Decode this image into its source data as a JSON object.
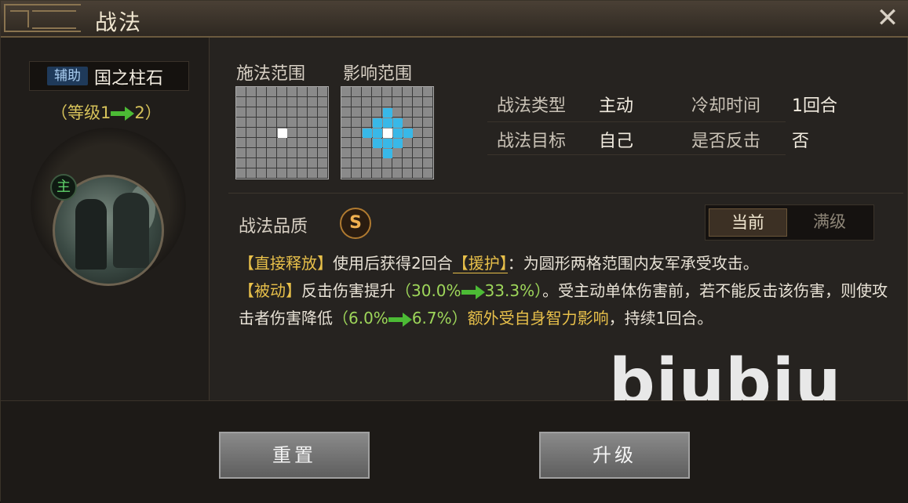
{
  "window": {
    "title": "战法",
    "close": "✕"
  },
  "skill": {
    "tag": "辅助",
    "name": "国之柱石",
    "level_open": "（等级1",
    "level_close": "2）",
    "commander_badge": "主"
  },
  "ranges": {
    "cast_label": "施法范围",
    "effect_label": "影响范围"
  },
  "info": {
    "type_label": "战法类型",
    "type_value": "主动",
    "cooldown_label": "冷却时间",
    "cooldown_value": "1回合",
    "target_label": "战法目标",
    "target_value": "自己",
    "counter_label": "是否反击",
    "counter_value": "否"
  },
  "quality": {
    "label": "战法品质",
    "grade": "S"
  },
  "toggle": {
    "current": "当前",
    "max": "满级"
  },
  "description": {
    "p1_kw": "【直接释放】",
    "p1_a": "使用后获得2回合",
    "p1_kw2": "【援护】",
    "p1_b": "：为圆形两格范围内友军承受攻击。",
    "p2_kw": "【被动】",
    "p2_a": "反击伤害提升",
    "p2_val1": "（30.0%",
    "p2_val2": "33.3%）",
    "p2_b": "。受主动单体伤害前，若不能反击该伤害，则使攻击者伤害降低",
    "p2_val3": "（6.0%",
    "p2_val4": "6.7%）",
    "p2_c": "额外受自身智力影响",
    "p2_d": "，持续1回合。"
  },
  "watermark": "biubiu",
  "buttons": {
    "reset": "重置",
    "upgrade": "升级"
  },
  "colors": {
    "accent_gold": "#e8c04a",
    "arrow_green": "#4cbb35",
    "range_blue": "#38b8e8"
  }
}
